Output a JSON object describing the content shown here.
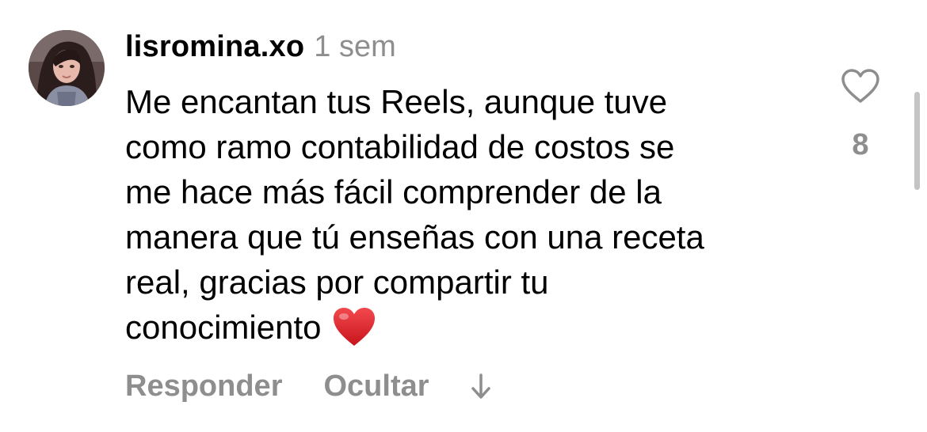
{
  "comment": {
    "username": "lisromina.xo",
    "timestamp": "1 sem",
    "text_lines": [
      "Me encantan tus Reels, aunque tuve",
      "como ramo contabilidad de costos se",
      "me hace más fácil comprender de la",
      "manera que tú enseñas con una receta",
      "real, gracias por compartir tu",
      "conocimiento"
    ],
    "trailing_emoji": "red-heart-emoji",
    "like_count": "8",
    "like_icon": "heart-outline-icon",
    "actions": {
      "reply_label": "Responder",
      "hide_label": "Ocultar",
      "expand_icon": "arrow-down-icon"
    }
  },
  "colors": {
    "text": "#000000",
    "secondary": "#8e8e8e",
    "heart_red": "#e0242c",
    "scrollbar": "#c4c4c4"
  }
}
